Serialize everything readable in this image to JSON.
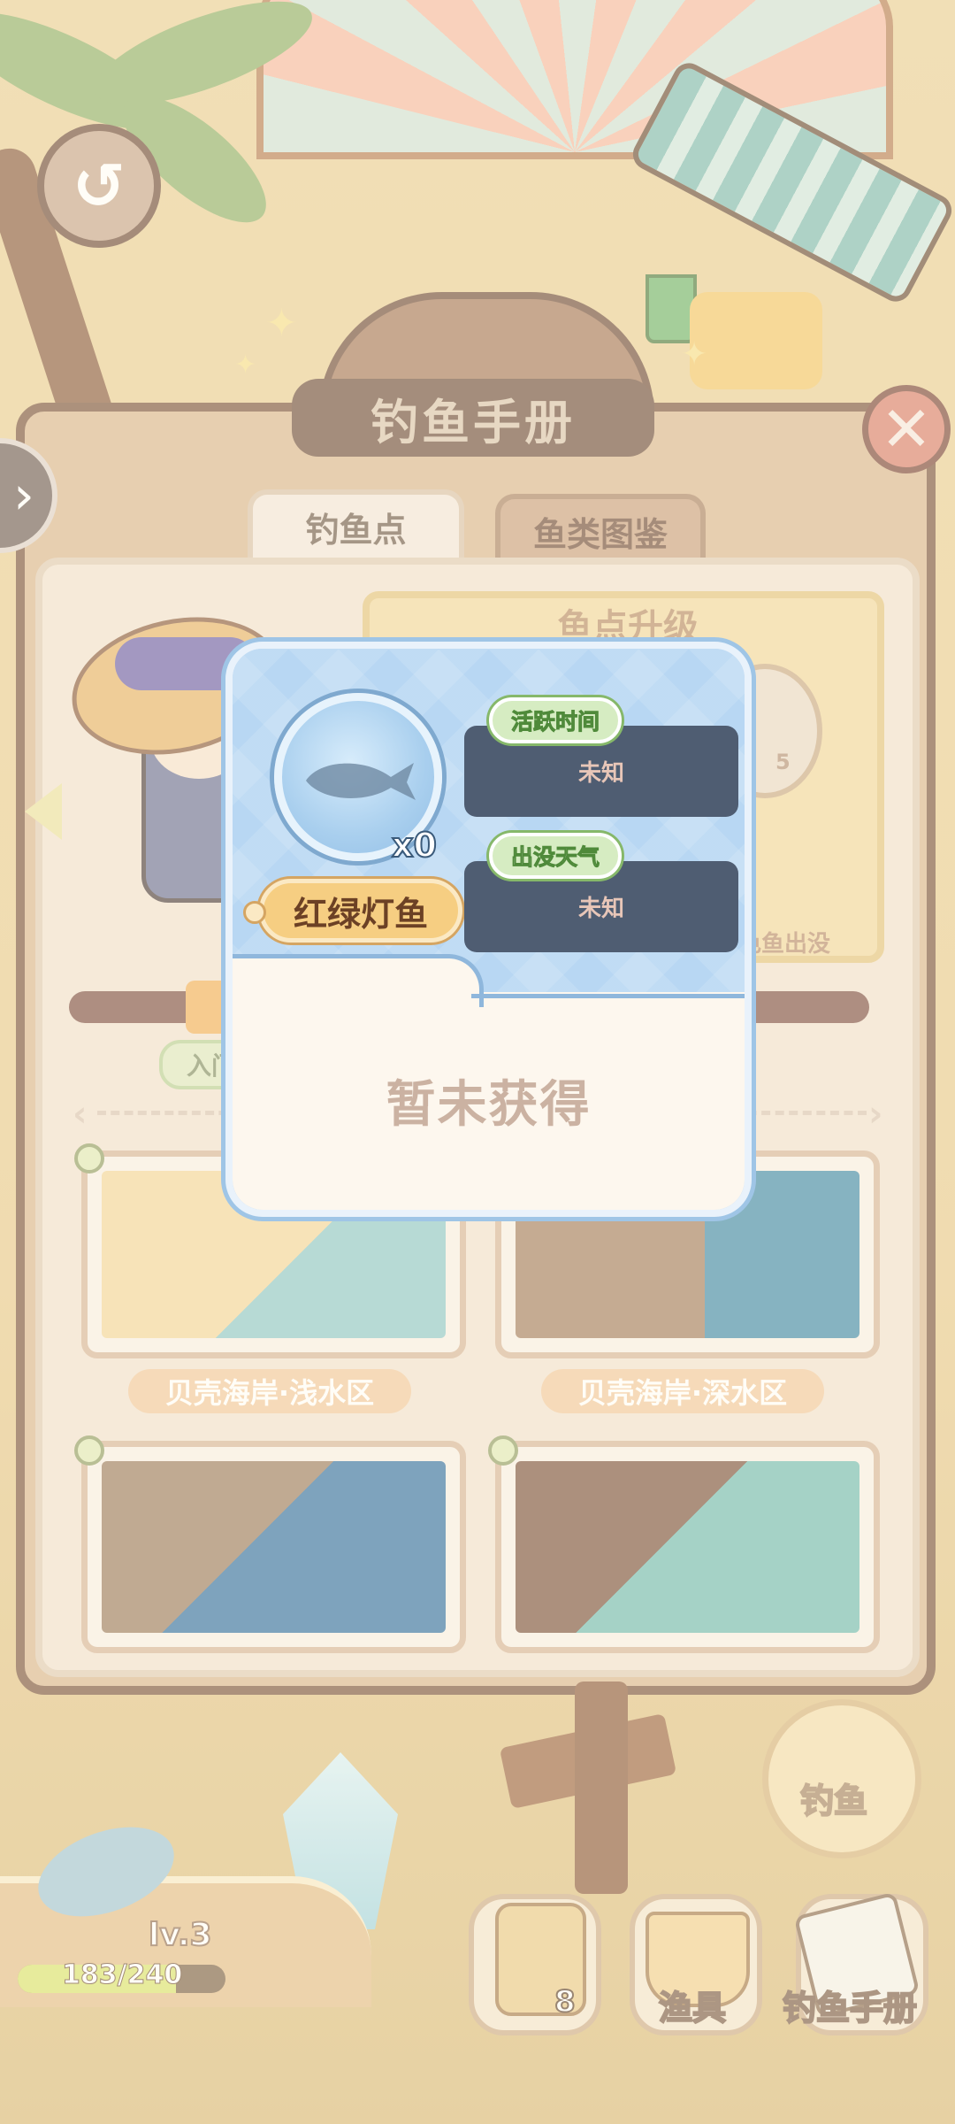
{
  "header": {
    "title": "钓鱼手册"
  },
  "tabs": [
    {
      "label": "钓鱼点",
      "active": true
    },
    {
      "label": "鱼类图鉴",
      "active": false
    }
  ],
  "upgrade": {
    "title": "鱼点升级",
    "fish_count": "5",
    "footer": "色鱼出没"
  },
  "enter_label": "入门",
  "spots": [
    {
      "label": "贝壳海岸·浅水区"
    },
    {
      "label": "贝壳海岸·深水区"
    },
    {
      "label": ""
    },
    {
      "label": ""
    }
  ],
  "modal": {
    "fish_name": "红绿灯鱼",
    "quantity": "x0",
    "active_time": {
      "label": "活跃时间",
      "value": "未知"
    },
    "weather": {
      "label": "出没天气",
      "value": "未知"
    },
    "status": "暂未获得"
  },
  "hud": {
    "level": "lv.3",
    "exp_text": "183/240",
    "exp_current": 183,
    "exp_max": 240,
    "fish_button": "钓鱼",
    "bag_count": "8",
    "gear_label": "渔具",
    "handbook_label": "钓鱼手册"
  },
  "icons": {
    "back": "back-arrow-icon",
    "close": "close-icon",
    "side": "chevron-right-icon"
  },
  "colors": {
    "panel_brown": "#7a5239",
    "modal_blue": "#b8d7f3",
    "pill_orange": "#f6ce82",
    "info_box": "#4f5d72",
    "tag_green": "#86b86a"
  }
}
